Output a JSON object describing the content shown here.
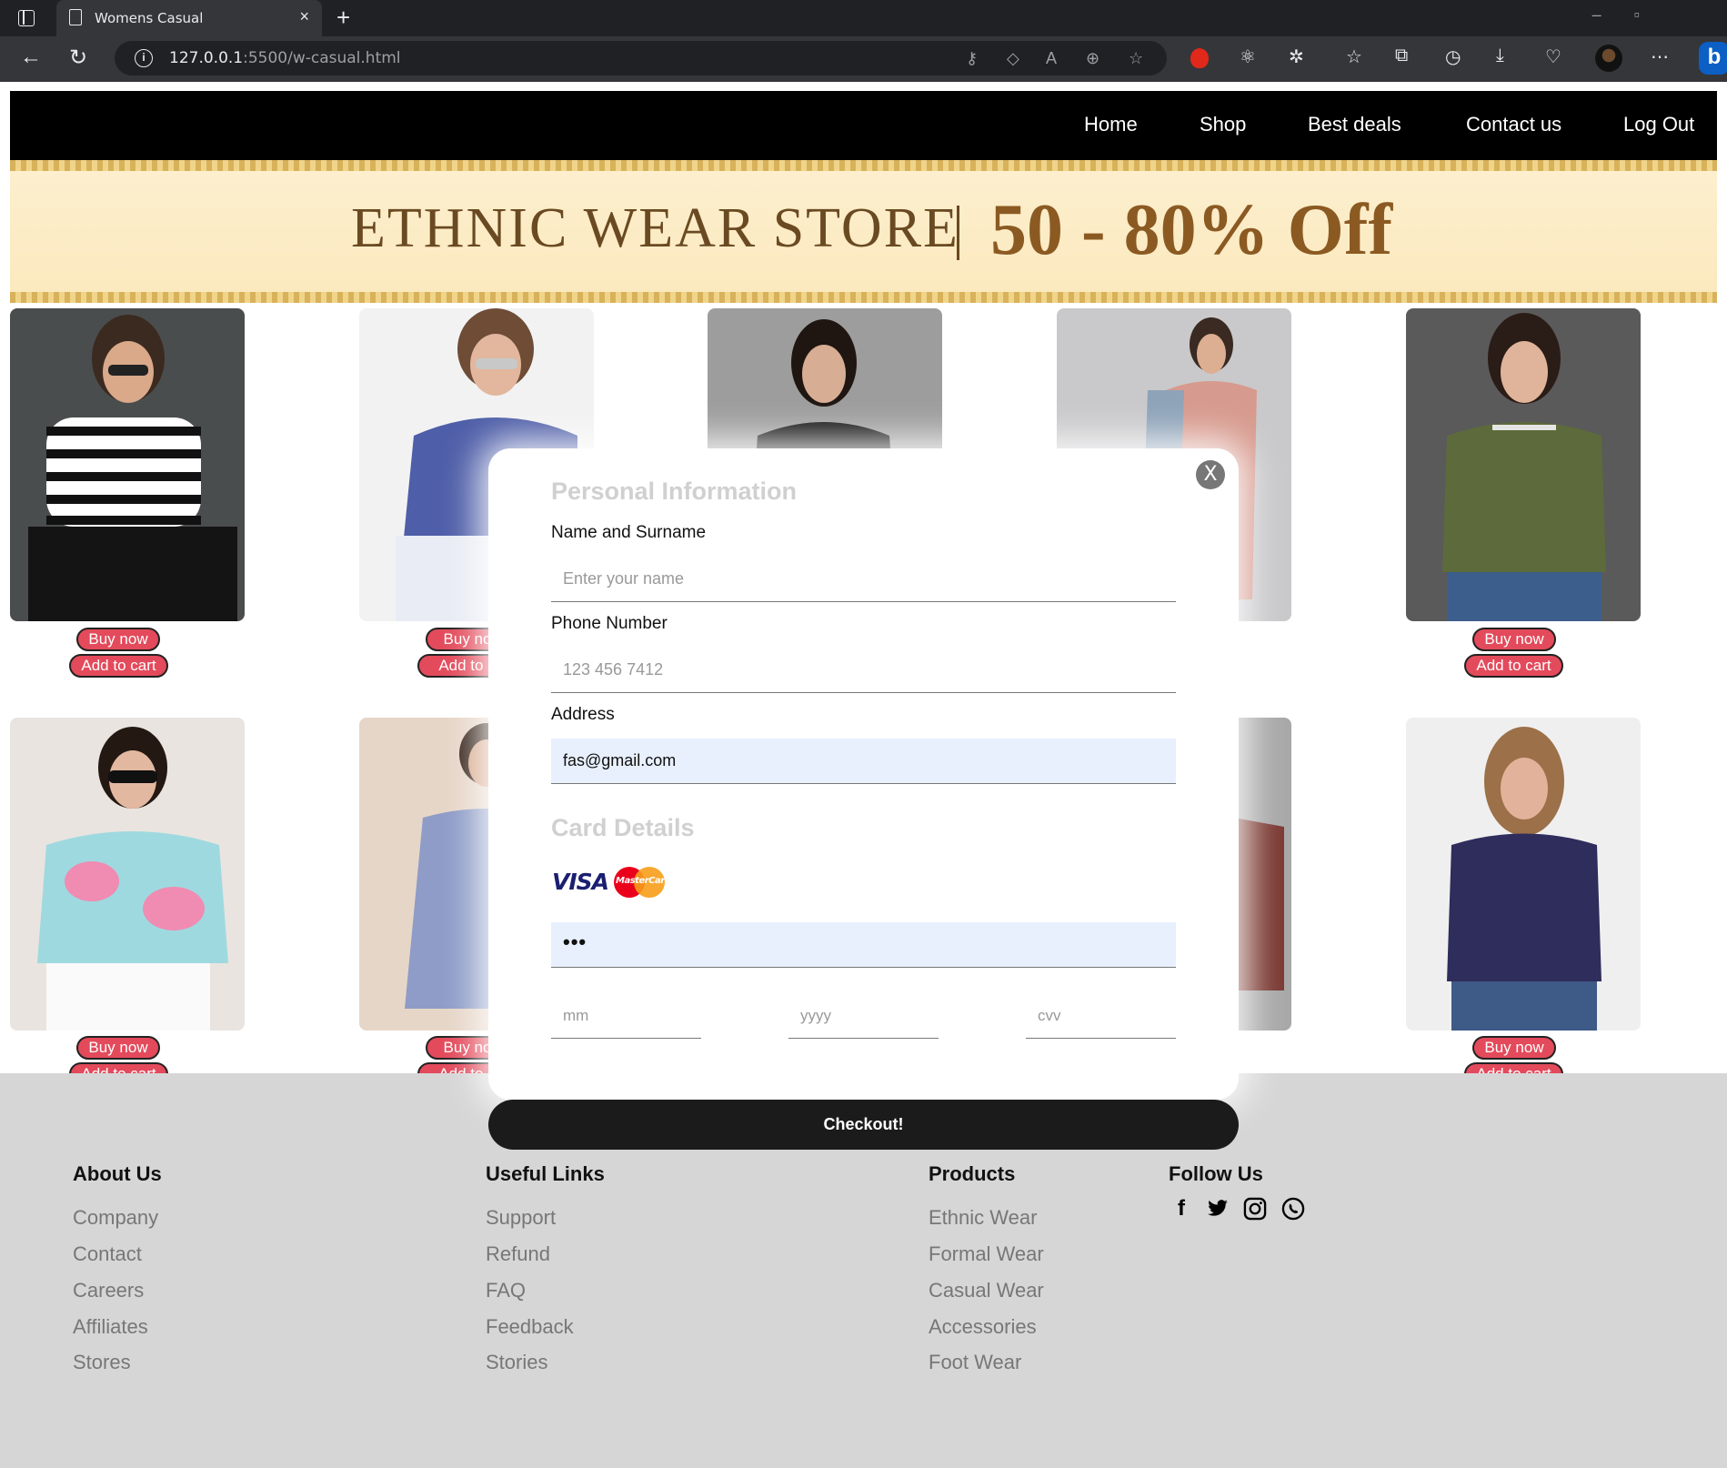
{
  "browser": {
    "tab_title": "Womens Casual",
    "tab_close": "×",
    "new_tab": "+",
    "url_host": "127.0.0.1",
    "url_rest": ":5500/w-casual.html"
  },
  "nav": {
    "links": [
      "Home",
      "Shop",
      "Best deals",
      "Contact us",
      "Log Out"
    ]
  },
  "banner": {
    "left_text": "ETHNIC WEAR STORE",
    "right_text": "50 - 80% Off"
  },
  "product_actions": {
    "buy_label": "Buy now",
    "cart_label": "Add to cart",
    "buy_label_clipped": "Buy no",
    "cart_label_clipped": "Add to c"
  },
  "modal": {
    "close_label": "X",
    "personal_title": "Personal Information",
    "name_label": "Name and Surname",
    "name_placeholder": "Enter your name",
    "phone_label": "Phone Number",
    "phone_placeholder": "123 456 7412",
    "address_label": "Address",
    "address_value": "fas@gmail.com",
    "card_title": "Card Details",
    "visa_label": "VISA",
    "mastercard_label": "MasterCard",
    "card_number_value": "•••",
    "month_placeholder": "mm",
    "year_placeholder": "yyyy",
    "cvv_placeholder": "cvv",
    "checkout_label": "Checkout!"
  },
  "footer": {
    "about": {
      "title": "About Us",
      "links": [
        "Company",
        "Contact",
        "Careers",
        "Affiliates",
        "Stores"
      ]
    },
    "useful": {
      "title": "Useful Links",
      "links": [
        "Support",
        "Refund",
        "FAQ",
        "Feedback",
        "Stories"
      ]
    },
    "products": {
      "title": "Products",
      "links": [
        "Ethnic Wear",
        "Formal Wear",
        "Casual Wear",
        "Accessories",
        "Foot Wear"
      ]
    },
    "follow": {
      "title": "Follow Us",
      "icons": [
        "facebook-icon",
        "twitter-icon",
        "instagram-icon",
        "whatsapp-icon"
      ]
    }
  },
  "colors": {
    "button_red": "#e34a5b",
    "nav_bg": "#000000",
    "footer_bg": "#d6d6d6",
    "checkout_bg": "#1b1b1b",
    "autofill_bg": "#e8f0fe"
  }
}
